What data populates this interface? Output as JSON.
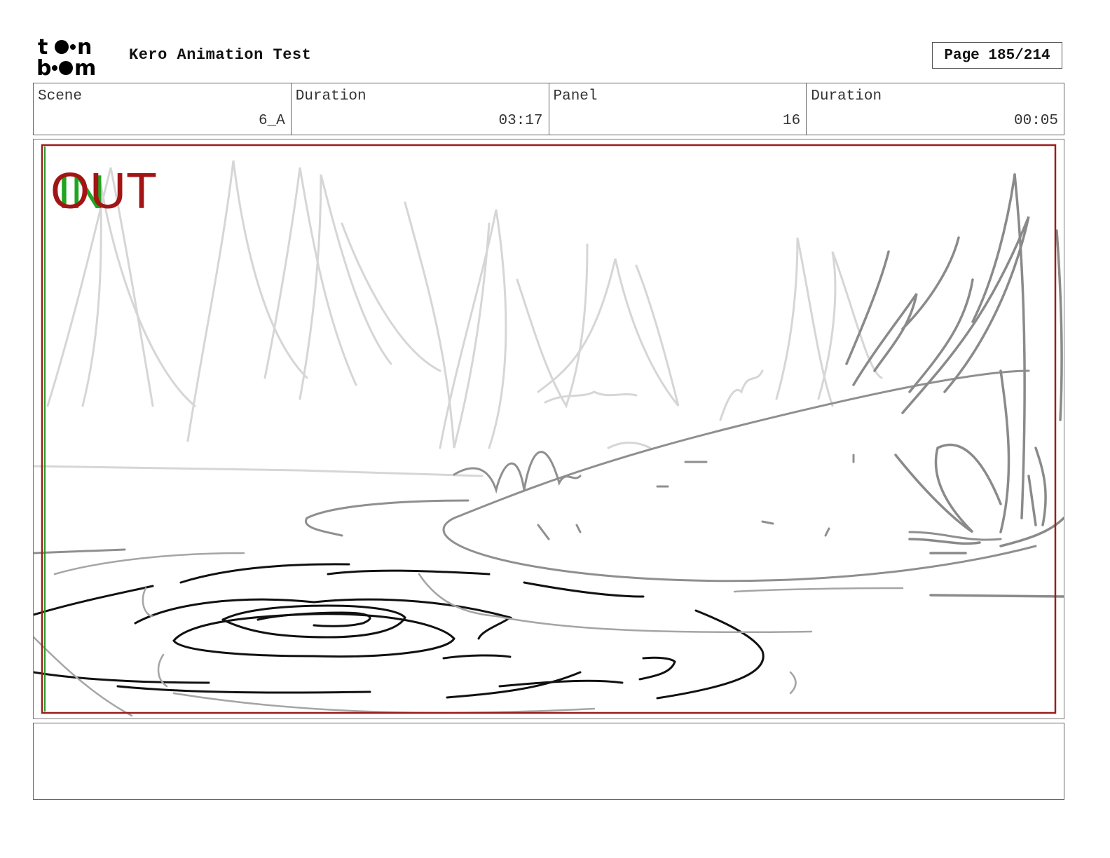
{
  "header": {
    "logo_text_top": "toon",
    "logo_text_bottom": "boom",
    "title": "Kero Animation Test",
    "page": "Page 185/214"
  },
  "info": {
    "scene_label": "Scene",
    "scene_value": "6_A",
    "duration_label": "Duration",
    "duration_value": "03:17",
    "panel_label": "Panel",
    "panel_value": "16",
    "panel_duration_label": "Duration",
    "panel_duration_value": "00:05"
  },
  "panel": {
    "in_marker": "IN",
    "out_marker": "OUT",
    "in_color": "#1fa51f",
    "out_color": "#a31515"
  },
  "notes": {
    "text": ""
  }
}
